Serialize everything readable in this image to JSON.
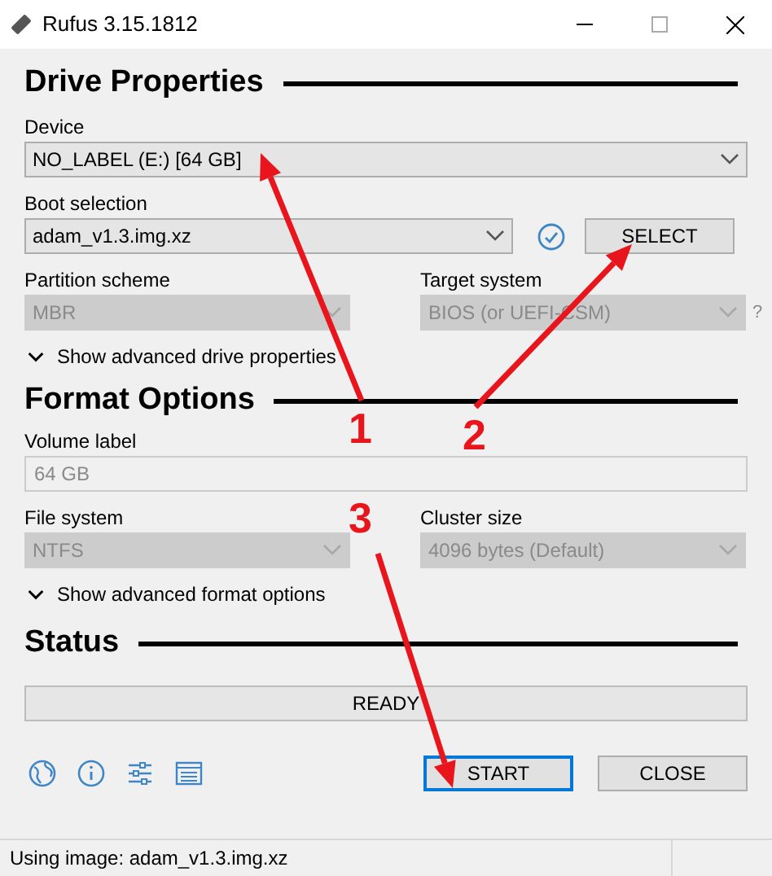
{
  "window": {
    "title": "Rufus 3.15.1812"
  },
  "drive_properties": {
    "heading": "Drive Properties",
    "device": {
      "label": "Device",
      "value": "NO_LABEL (E:) [64 GB]",
      "disabled": false
    },
    "boot_selection": {
      "label": "Boot selection",
      "value": "adam_v1.3.img.xz",
      "disabled": false
    },
    "select_button": "SELECT",
    "partition_scheme": {
      "label": "Partition scheme",
      "value": "MBR",
      "disabled": true
    },
    "target_system": {
      "label": "Target system",
      "value": "BIOS (or UEFI-CSM)",
      "disabled": true
    },
    "help": "?",
    "advanced_toggle": {
      "label": "Show advanced drive properties",
      "expanded": false
    }
  },
  "format_options": {
    "heading": "Format Options",
    "volume_label": {
      "label": "Volume label",
      "value": "64 GB",
      "disabled": true
    },
    "file_system": {
      "label": "File system",
      "value": "NTFS",
      "disabled": true
    },
    "cluster_size": {
      "label": "Cluster size",
      "value": "4096 bytes (Default)",
      "disabled": true
    },
    "advanced_toggle": {
      "label": "Show advanced format options",
      "expanded": false
    }
  },
  "status": {
    "heading": "Status",
    "progress": {
      "text": "READY"
    }
  },
  "buttons": [
    {
      "label": "START",
      "selected": true
    },
    {
      "label": "CLOSE",
      "selected": false
    }
  ],
  "status_bar": "Using image: adam_v1.3.img.xz",
  "annotations": [
    {
      "label": "1"
    },
    {
      "label": "2"
    },
    {
      "label": "3"
    }
  ]
}
